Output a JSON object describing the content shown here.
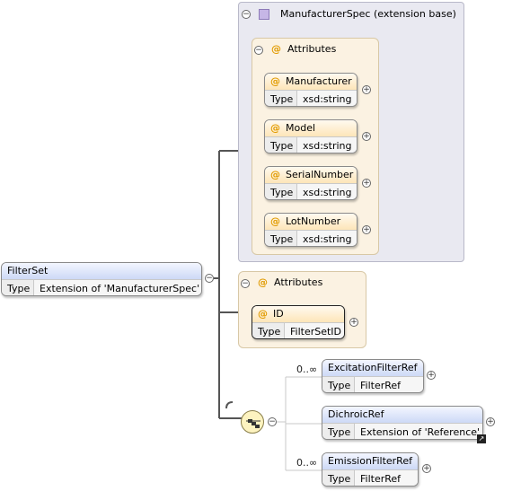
{
  "root": {
    "name": "FilterSet",
    "type_key": "Type",
    "type_value": "Extension of 'ManufacturerSpec'"
  },
  "ext_base": {
    "title": "ManufacturerSpec (extension base)",
    "attributes_label": "Attributes",
    "attributes": [
      {
        "name": "Manufacturer",
        "type_key": "Type",
        "type_value": "xsd:string"
      },
      {
        "name": "Model",
        "type_key": "Type",
        "type_value": "xsd:string"
      },
      {
        "name": "SerialNumber",
        "type_key": "Type",
        "type_value": "xsd:string"
      },
      {
        "name": "LotNumber",
        "type_key": "Type",
        "type_value": "xsd:string"
      }
    ]
  },
  "own_attributes": {
    "label": "Attributes",
    "items": [
      {
        "name": "ID",
        "type_key": "Type",
        "type_value": "FilterSetID"
      }
    ]
  },
  "sequence": {
    "children": [
      {
        "name": "ExcitationFilterRef",
        "cardinality": "0..∞",
        "type_key": "Type",
        "type_value": "FilterRef"
      },
      {
        "name": "DichroicRef",
        "cardinality": "",
        "type_key": "Type",
        "type_value": "Extension of 'Reference'"
      },
      {
        "name": "EmissionFilterRef",
        "cardinality": "0..∞",
        "type_key": "Type",
        "type_value": "FilterRef"
      }
    ]
  },
  "symbols": {
    "at": "@",
    "collapse": "⊖",
    "expand": "+",
    "minus": "−"
  }
}
